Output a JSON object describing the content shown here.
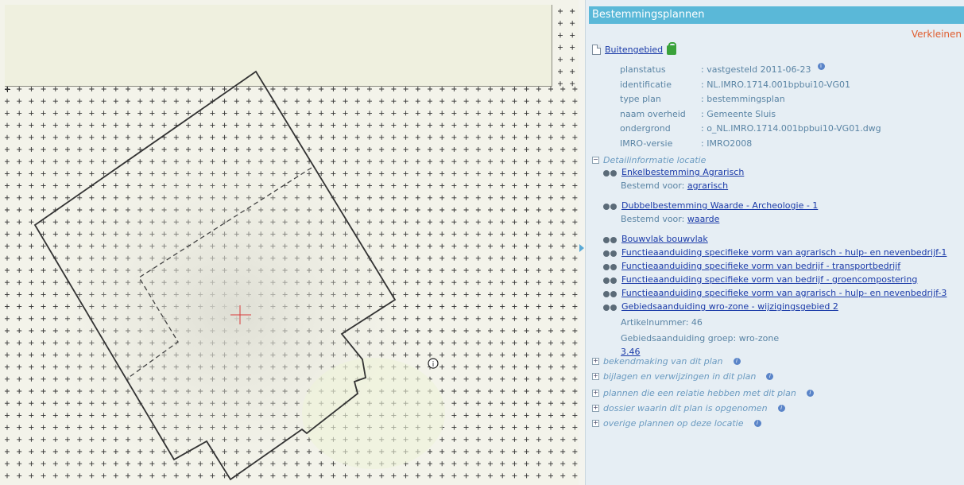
{
  "panel": {
    "title": "Bestemmingsplannen",
    "collapse_label": "Verkleinen",
    "plan_name": "Buitengebied",
    "meta": [
      {
        "key": "planstatus",
        "value": ": vastgesteld 2011-06-23"
      },
      {
        "key": "identificatie",
        "value": ": NL.IMRO.1714.001bpbui10-VG01"
      },
      {
        "key": "type plan",
        "value": ": bestemmingsplan"
      },
      {
        "key": "naam overheid",
        "value": ": Gemeente Sluis"
      },
      {
        "key": "ondergrond",
        "value": ": o_NL.IMRO.1714.001bpbui10-VG01.dwg"
      },
      {
        "key": "IMRO-versie",
        "value": ": IMRO2008"
      }
    ],
    "detail_header": "Detailinformatie locatie",
    "details": {
      "d0": "Enkelbestemming Agrarisch",
      "d0_sub_label": "Bestemd voor:",
      "d0_sub_link": "agrarisch",
      "d1": "Dubbelbestemming Waarde - Archeologie - 1",
      "d1_sub_label": "Bestemd voor:",
      "d1_sub_link": "waarde",
      "d2": "Bouwvlak bouwvlak",
      "d3": "Functieaanduiding specifieke vorm van agrarisch - hulp- en nevenbedrijf-1",
      "d4": "Functieaanduiding specifieke vorm van bedrijf - transportbedrijf",
      "d5": "Functieaanduiding specifieke vorm van bedrijf - groencompostering",
      "d6": "Functieaanduiding specifieke vorm van agrarisch - hulp- en nevenbedrijf-3",
      "d7": "Gebiedsaanduiding wro-zone - wijzigingsgebied 2",
      "d7_article": "Artikelnummer: 46",
      "d7_group": "Gebiedsaanduiding groep: wro-zone",
      "d7_link": "3.46"
    },
    "sections": [
      "bekendmaking van dit plan",
      "bijlagen en verwijzingen in dit plan",
      "plannen die een relatie hebben met dit plan",
      "dossier waarin dit plan is opgenomen",
      "overige plannen op deze locatie"
    ]
  },
  "map": {
    "info_marker": "i"
  }
}
